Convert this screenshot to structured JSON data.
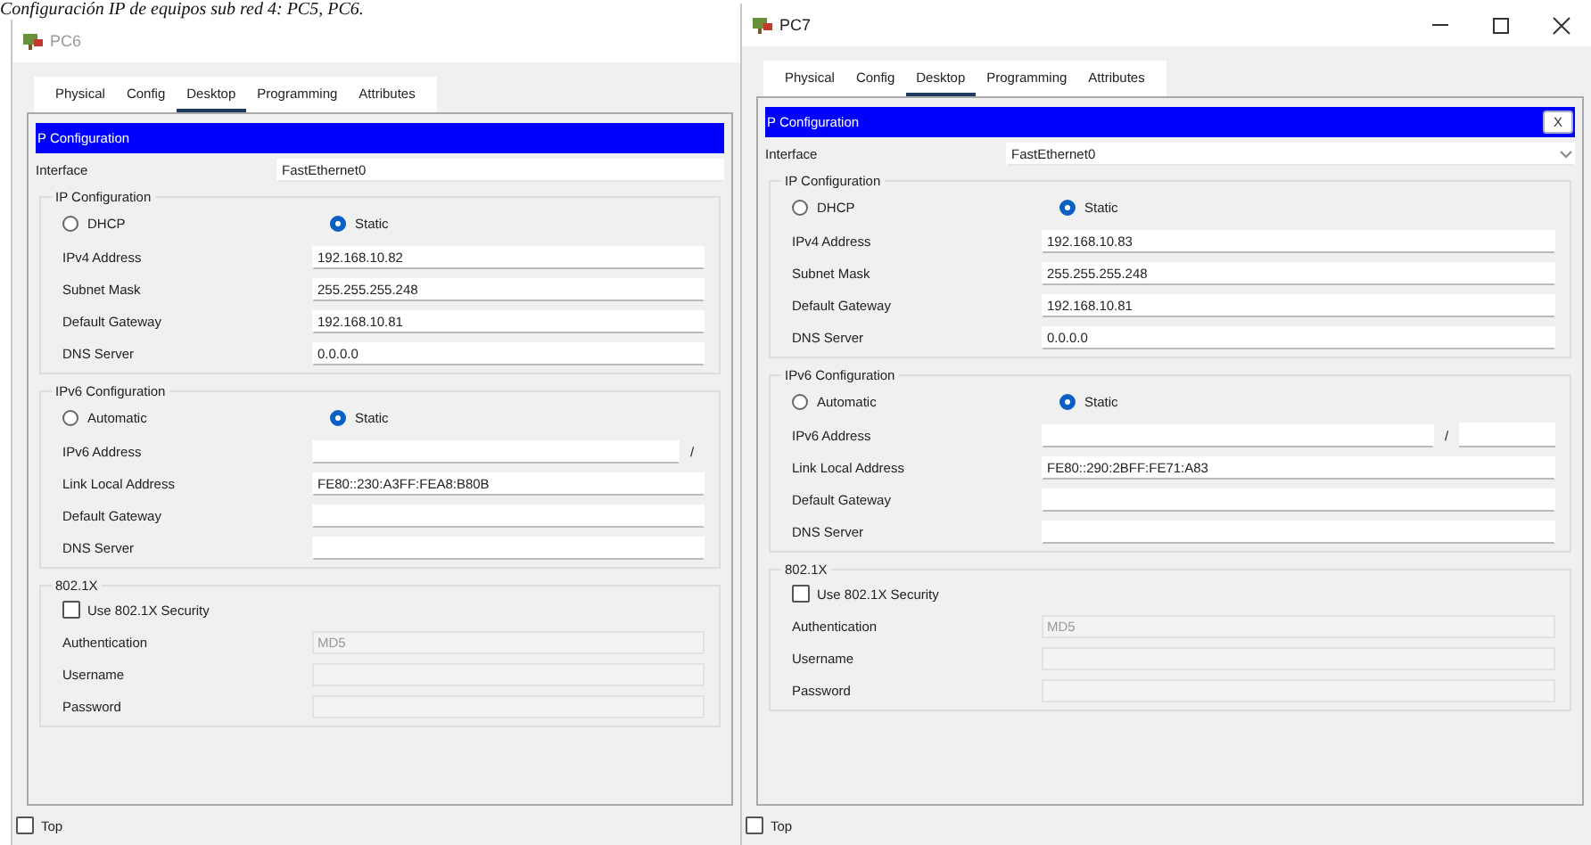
{
  "caption": "Configuración IP de equipos sub red 4: PC5, PC6.",
  "windows": [
    {
      "title": "PC6",
      "active": false,
      "tabs": [
        {
          "label": "Physical",
          "selected": false
        },
        {
          "label": "Config",
          "selected": false
        },
        {
          "label": "Desktop",
          "selected": true
        },
        {
          "label": "Programming",
          "selected": false
        },
        {
          "label": "Attributes",
          "selected": false
        }
      ],
      "panel_title": "P Configuration",
      "interface": {
        "label": "Interface",
        "value": "FastEthernet0"
      },
      "ipv4": {
        "legend": "IP Configuration",
        "modes": [
          {
            "label": "DHCP",
            "selected": false
          },
          {
            "label": "Static",
            "selected": true
          }
        ],
        "fields": [
          {
            "label": "IPv4 Address",
            "value": "192.168.10.82"
          },
          {
            "label": "Subnet Mask",
            "value": "255.255.255.248"
          },
          {
            "label": "Default Gateway",
            "value": "192.168.10.81"
          },
          {
            "label": "DNS Server",
            "value": "0.0.0.0"
          }
        ]
      },
      "ipv6": {
        "legend": "IPv6 Configuration",
        "modes": [
          {
            "label": "Automatic",
            "selected": false
          },
          {
            "label": "Static",
            "selected": true
          }
        ],
        "address_label": "IPv6 Address",
        "prefix_separator": "/",
        "fields": [
          {
            "label": "Link Local Address",
            "value": "FE80::230:A3FF:FEA8:B80B"
          },
          {
            "label": "Default Gateway"
          },
          {
            "label": "DNS Server"
          }
        ]
      },
      "dot1x": {
        "legend": "802.1X",
        "security": {
          "label": "Use 802.1X Security",
          "checked": false
        },
        "fields": [
          {
            "label": "Authentication",
            "value": "MD5",
            "disabled": true
          },
          {
            "label": "Username",
            "disabled": true
          },
          {
            "label": "Password",
            "disabled": true
          }
        ]
      },
      "top": {
        "label": "Top",
        "checked": false
      }
    },
    {
      "title": "PC7",
      "active": true,
      "tabs": [
        {
          "label": "Physical",
          "selected": false
        },
        {
          "label": "Config",
          "selected": false
        },
        {
          "label": "Desktop",
          "selected": true
        },
        {
          "label": "Programming",
          "selected": false
        },
        {
          "label": "Attributes",
          "selected": false
        }
      ],
      "panel_title": "P Configuration",
      "close_label": "X",
      "interface": {
        "label": "Interface",
        "value": "FastEthernet0"
      },
      "ipv4": {
        "legend": "IP Configuration",
        "modes": [
          {
            "label": "DHCP",
            "selected": false
          },
          {
            "label": "Static",
            "selected": true
          }
        ],
        "fields": [
          {
            "label": "IPv4 Address",
            "value": "192.168.10.83"
          },
          {
            "label": "Subnet Mask",
            "value": "255.255.255.248"
          },
          {
            "label": "Default Gateway",
            "value": "192.168.10.81"
          },
          {
            "label": "DNS Server",
            "value": "0.0.0.0"
          }
        ]
      },
      "ipv6": {
        "legend": "IPv6 Configuration",
        "modes": [
          {
            "label": "Automatic",
            "selected": false
          },
          {
            "label": "Static",
            "selected": true
          }
        ],
        "address_label": "IPv6 Address",
        "prefix_separator": "/",
        "prefix_field": true,
        "fields": [
          {
            "label": "Link Local Address",
            "value": "FE80::290:2BFF:FE71:A83"
          },
          {
            "label": "Default Gateway"
          },
          {
            "label": "DNS Server"
          }
        ]
      },
      "dot1x": {
        "legend": "802.1X",
        "security": {
          "label": "Use 802.1X Security",
          "checked": false
        },
        "fields": [
          {
            "label": "Authentication",
            "value": "MD5",
            "disabled": true
          },
          {
            "label": "Username",
            "disabled": true
          },
          {
            "label": "Password",
            "disabled": true
          }
        ]
      },
      "top": {
        "label": "Top",
        "checked": false
      }
    }
  ]
}
